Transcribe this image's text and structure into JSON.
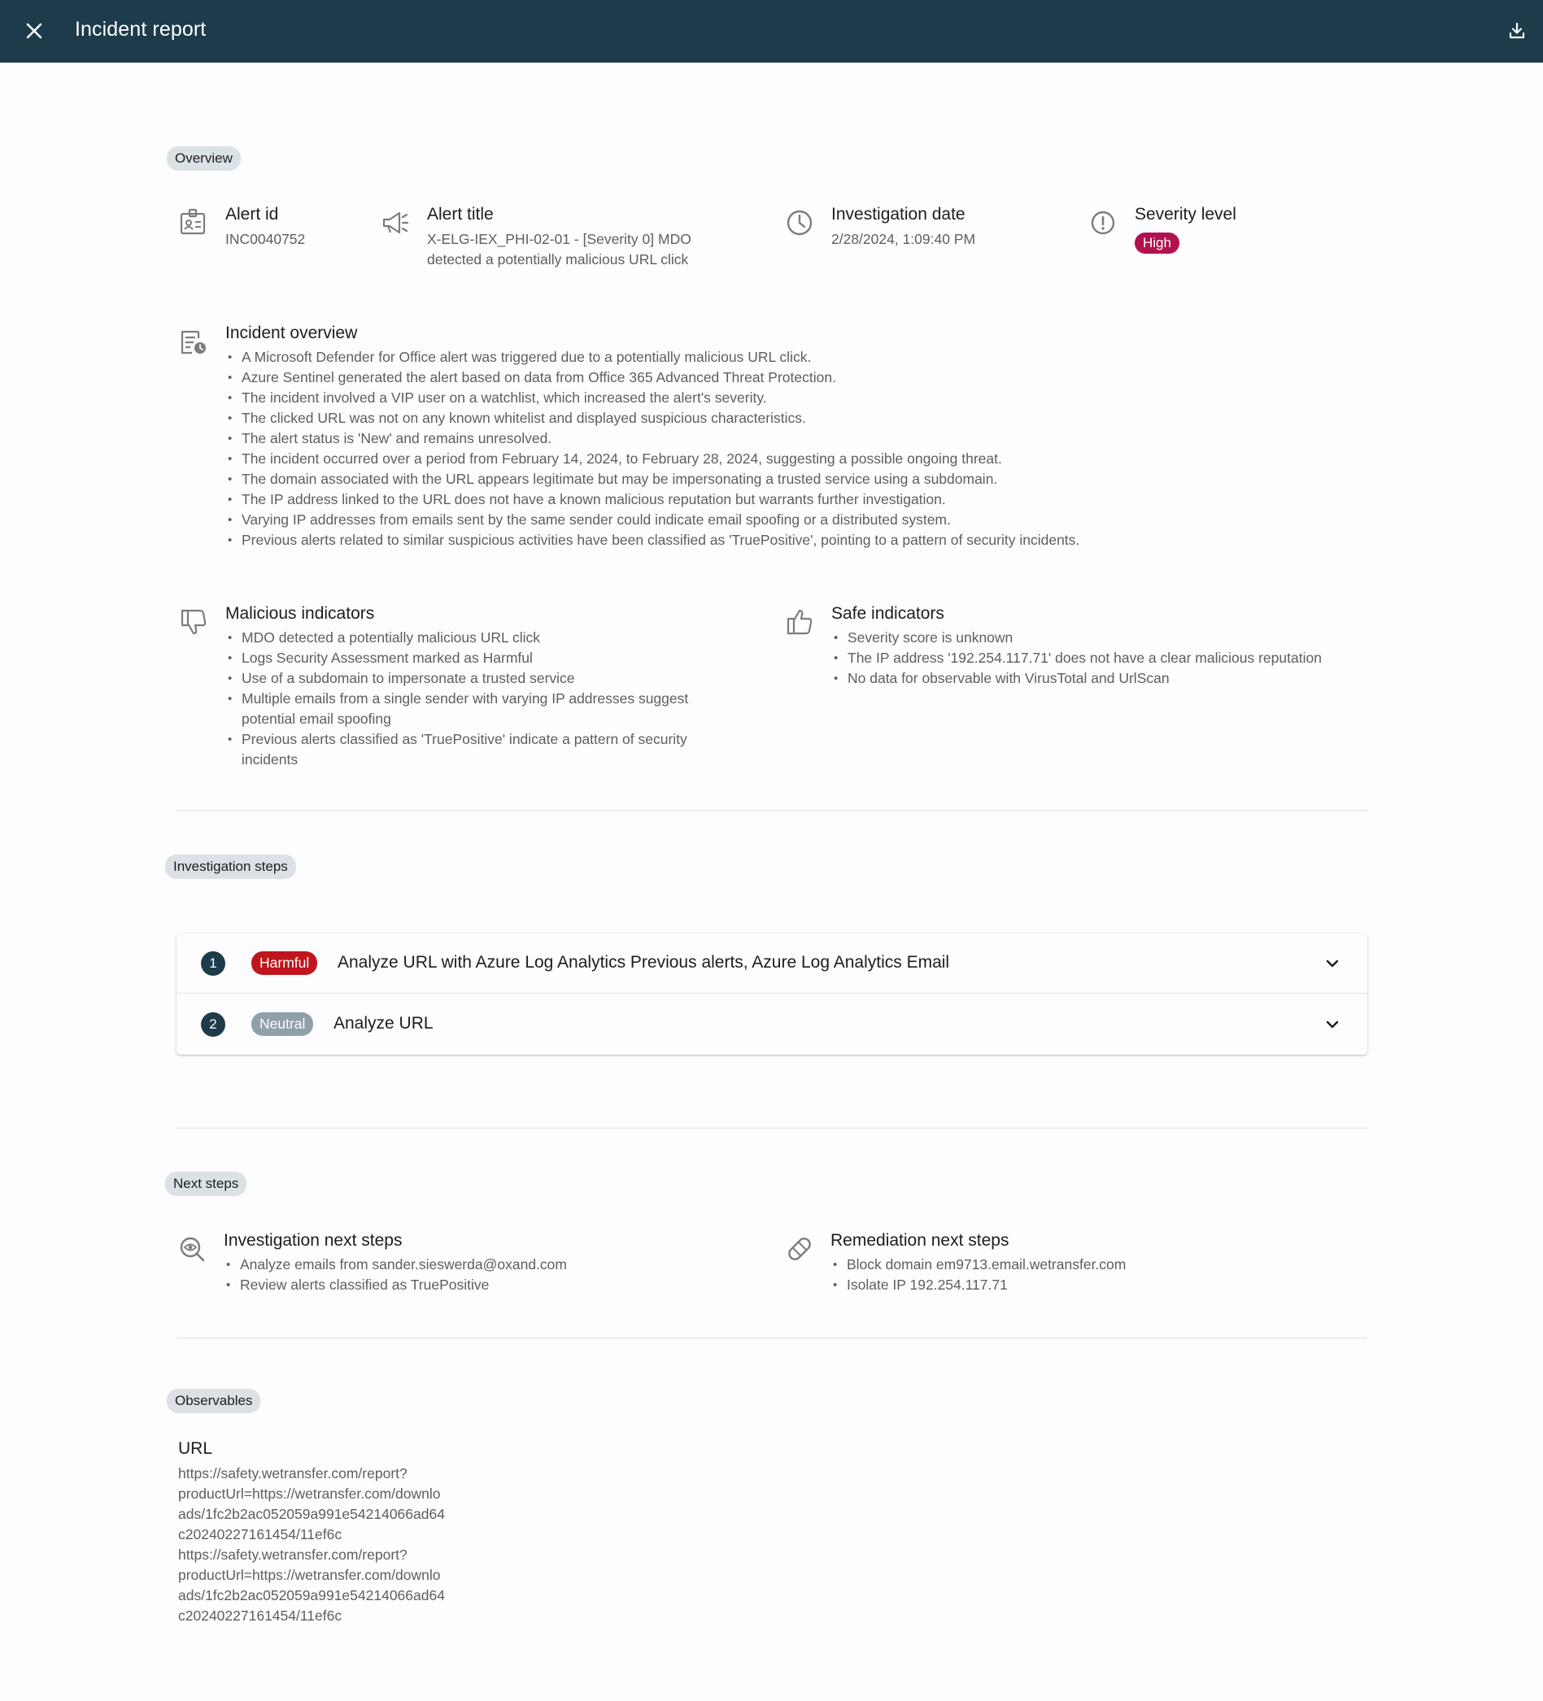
{
  "header": {
    "title": "Incident report",
    "close_icon": "close-icon",
    "download_icon": "download-icon"
  },
  "sections": {
    "overview": "Overview",
    "investigation_steps": "Investigation steps",
    "next_steps": "Next steps",
    "observables": "Observables"
  },
  "overview": {
    "alert_id": {
      "label": "Alert id",
      "value": "INC0040752",
      "icon": "id-badge-icon"
    },
    "alert_title": {
      "label": "Alert title",
      "value_line1": "X-ELG-IEX_PHI-02-01 - [Severity 0] MDO",
      "value_line2": "detected a potentially malicious URL click",
      "icon": "megaphone-icon"
    },
    "investigation_date": {
      "label": "Investigation date",
      "value": "2/28/2024, 1:09:40 PM",
      "icon": "clock-icon"
    },
    "severity": {
      "label": "Severity level",
      "value": "High",
      "icon": "alert-circle-icon",
      "color": "#b0124f"
    }
  },
  "incident_overview": {
    "title": "Incident overview",
    "items": [
      "A Microsoft Defender for Office alert was triggered due to a potentially malicious URL click.",
      "Azure Sentinel generated the alert based on data from Office 365 Advanced Threat Protection.",
      "The incident involved a VIP user on a watchlist, which increased the alert's severity.",
      "The clicked URL was not on any known whitelist and displayed suspicious characteristics.",
      "The alert status is 'New' and remains unresolved.",
      "The incident occurred over a period from February 14, 2024, to February 28, 2024, suggesting a possible ongoing threat.",
      "The domain associated with the URL appears legitimate but may be impersonating a trusted service using a subdomain.",
      "The IP address linked to the URL does not have a known malicious reputation but warrants further investigation.",
      "Varying IP addresses from emails sent by the same sender could indicate email spoofing or a distributed system.",
      "Previous alerts related to similar suspicious activities have been classified as 'TruePositive', pointing to a pattern of security incidents."
    ]
  },
  "malicious_indicators": {
    "title": "Malicious indicators",
    "items": [
      "MDO detected a potentially malicious URL click",
      "Logs Security Assessment marked as Harmful",
      "Use of a subdomain to impersonate a trusted service",
      "Multiple emails from a single sender with varying IP addresses suggest potential email spoofing",
      "Previous alerts classified as 'TruePositive' indicate a pattern of security incidents"
    ]
  },
  "safe_indicators": {
    "title": "Safe indicators",
    "items": [
      "Severity score is unknown",
      "The IP address '192.254.117.71' does not have a clear malicious reputation",
      "No data for observable with VirusTotal and UrlScan"
    ]
  },
  "steps": [
    {
      "number": "1",
      "badge": "Harmful",
      "title": "Analyze URL with Azure Log Analytics Previous alerts, Azure Log Analytics Email"
    },
    {
      "number": "2",
      "badge": "Neutral",
      "title": "Analyze URL"
    }
  ],
  "next_steps": {
    "investigation": {
      "title": "Investigation next steps",
      "items": [
        "Analyze emails from sander.sieswerda@oxand.com",
        "Review alerts classified as TruePositive"
      ]
    },
    "remediation": {
      "title": "Remediation next steps",
      "items": [
        "Block domain em9713.email.wetransfer.com",
        "Isolate IP 192.254.117.71"
      ]
    }
  },
  "observables": {
    "url_label": "URL",
    "url_lines": [
      "https://safety.wetransfer.com/report?",
      "productUrl=https://wetransfer.com/downlo",
      "ads/1fc2b2ac052059a991e54214066ad64",
      "c20240227161454/11ef6c",
      "https://safety.wetransfer.com/report?",
      "productUrl=https://wetransfer.com/downlo",
      "ads/1fc2b2ac052059a991e54214066ad64",
      "c20240227161454/11ef6c"
    ]
  }
}
